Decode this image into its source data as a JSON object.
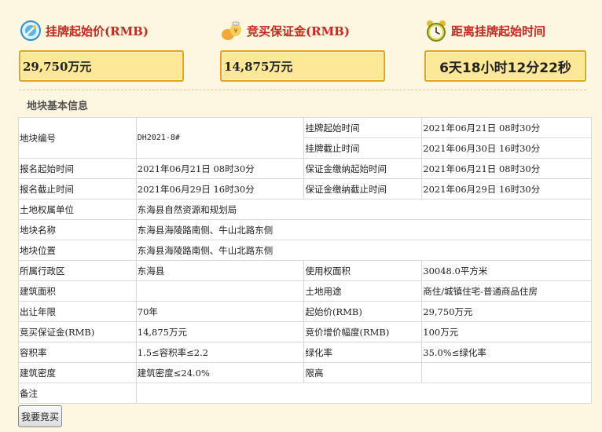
{
  "header": {
    "start_price_label": "挂牌起始价(RMB)",
    "start_price_value": "29,750万元",
    "deposit_label": "竞买保证金(RMB)",
    "deposit_value": "14,875万元",
    "countdown_label": "距离挂牌起始时间",
    "countdown_value": "6天18小时12分22秒"
  },
  "icons": {
    "start_price": "price-tag-icon",
    "deposit": "money-bag-icon",
    "countdown": "alarm-clock-icon"
  },
  "colors": {
    "accent_red": "#c8281e",
    "box_fill": "#fde897",
    "box_border": "#e4a41e",
    "page_bg": "#fdf6e0"
  },
  "section_title": "地块基本信息",
  "table": {
    "parcel_no_label": "地块编号",
    "parcel_no_value": "DH2021-8#",
    "list_start_label": "挂牌起始时间",
    "list_start_value": "2021年06月21日 08时30分",
    "list_end_label": "挂牌截止时间",
    "list_end_value": "2021年06月30日 16时30分",
    "reg_start_label": "报名起始时间",
    "reg_start_value": "2021年06月21日 08时30分",
    "dep_start_label": "保证金缴纳起始时间",
    "dep_start_value": "2021年06月21日 08时30分",
    "reg_end_label": "报名截止时间",
    "reg_end_value": "2021年06月29日 16时30分",
    "dep_end_label": "保证金缴纳截止时间",
    "dep_end_value": "2021年06月29日 16时30分",
    "owner_label": "土地权属单位",
    "owner_value": "东海县自然资源和规划局",
    "name_label": "地块名称",
    "name_value": "东海县海陵路南侧、牛山北路东侧",
    "location_label": "地块位置",
    "location_value": "东海县海陵路南侧、牛山北路东侧",
    "district_label": "所属行政区",
    "district_value": "东海县",
    "area_label": "使用权面积",
    "area_value": "30048.0平方米",
    "building_area_label": "建筑面积",
    "building_area_value": "",
    "usage_label": "土地用途",
    "usage_value": "商住/城镇住宅-普通商品住房",
    "term_label": "出让年限",
    "term_value": "70年",
    "start_price_label": "起始价(RMB)",
    "start_price_value": "29,750万元",
    "deposit_label": "竞买保证金(RMB)",
    "deposit_value": "14,875万元",
    "increment_label": "竞价增价幅度(RMB)",
    "increment_value": "100万元",
    "far_label": "容积率",
    "far_value": "1.5≤容积率≤2.2",
    "green_label": "绿化率",
    "green_value": "35.0%≤绿化率",
    "density_label": "建筑密度",
    "density_value": "建筑密度≤24.0%",
    "height_label": "限高",
    "height_value": "",
    "remark_label": "备注",
    "remark_value": ""
  },
  "bid_button_label": "我要竞买"
}
